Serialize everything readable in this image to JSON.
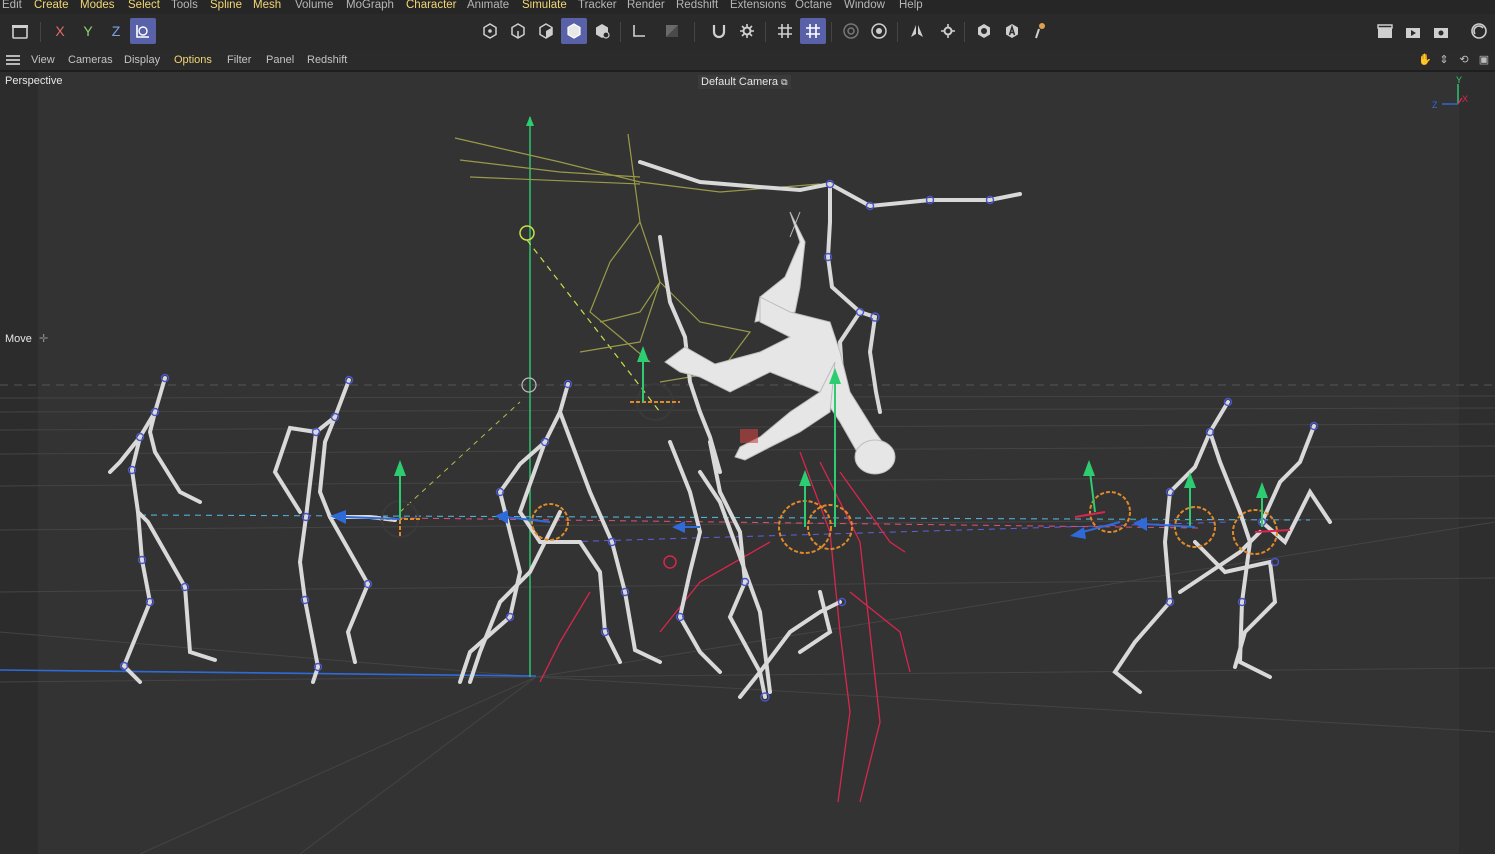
{
  "menu": [
    "Edit",
    "Create",
    "Modes",
    "Select",
    "Tools",
    "Spline",
    "Mesh",
    "Volume",
    "MoGraph",
    "Character",
    "Animate",
    "Simulate",
    "Tracker",
    "Render",
    "Redshift",
    "Extensions",
    "Octane",
    "Window",
    "Help"
  ],
  "toolbar": {
    "axis_x": "X",
    "axis_y": "Y",
    "axis_z": "Z",
    "accent_color": "#5962a8"
  },
  "viewmenu": [
    "View",
    "Cameras",
    "Display",
    "Options",
    "Filter",
    "Panel",
    "Redshift"
  ],
  "viewport": {
    "projection": "Perspective",
    "camera": "Default Camera",
    "active_tool": "Move",
    "axis_gizmo": {
      "y": "Y",
      "x": "X",
      "z": "Z"
    }
  }
}
